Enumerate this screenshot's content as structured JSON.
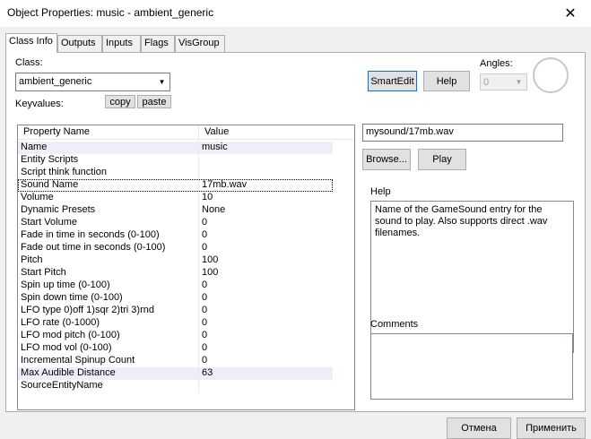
{
  "window": {
    "title": "Object Properties: music - ambient_generic"
  },
  "tabs": [
    {
      "label": "Class Info"
    },
    {
      "label": "Outputs"
    },
    {
      "label": "Inputs"
    },
    {
      "label": "Flags"
    },
    {
      "label": "VisGroup"
    }
  ],
  "class_info": {
    "class_label": "Class:",
    "class_value": "ambient_generic",
    "keyvalues_label": "Keyvalues:",
    "copy_label": "copy",
    "paste_label": "paste",
    "smartedit_label": "SmartEdit",
    "help_button_label": "Help",
    "angles_label": "Angles:",
    "angles_value": "0"
  },
  "grid": {
    "columns": [
      "Property Name",
      "Value"
    ],
    "rows": [
      {
        "name": "Name",
        "value": "music"
      },
      {
        "name": "Entity Scripts",
        "value": ""
      },
      {
        "name": "Script think function",
        "value": ""
      },
      {
        "name": "Sound Name",
        "value": "17mb.wav"
      },
      {
        "name": "Volume",
        "value": "10"
      },
      {
        "name": "Dynamic Presets",
        "value": "None"
      },
      {
        "name": "Start Volume",
        "value": "0"
      },
      {
        "name": "Fade in time in seconds (0-100)",
        "value": "0"
      },
      {
        "name": "Fade out time in seconds (0-100)",
        "value": "0"
      },
      {
        "name": "Pitch",
        "value": "100"
      },
      {
        "name": "Start Pitch",
        "value": "100"
      },
      {
        "name": "Spin up time (0-100)",
        "value": "0"
      },
      {
        "name": "Spin down time (0-100)",
        "value": "0"
      },
      {
        "name": "LFO type 0)off 1)sqr 2)tri 3)rnd",
        "value": "0"
      },
      {
        "name": "LFO rate (0-1000)",
        "value": "0"
      },
      {
        "name": "LFO mod pitch (0-100)",
        "value": "0"
      },
      {
        "name": "LFO mod vol (0-100)",
        "value": "0"
      },
      {
        "name": "Incremental Spinup Count",
        "value": "0"
      },
      {
        "name": "Max Audible Distance",
        "value": "63"
      },
      {
        "name": "SourceEntityName",
        "value": ""
      }
    ]
  },
  "sound": {
    "value": "mysound/17mb.wav",
    "browse_label": "Browse...",
    "play_label": "Play"
  },
  "help": {
    "label": "Help",
    "text": "Name of the GameSound entry for the sound to play. Also supports direct .wav filenames."
  },
  "comments": {
    "label": "Comments",
    "text": ""
  },
  "footer": {
    "cancel_label": "Отмена",
    "apply_label": "Применить"
  }
}
